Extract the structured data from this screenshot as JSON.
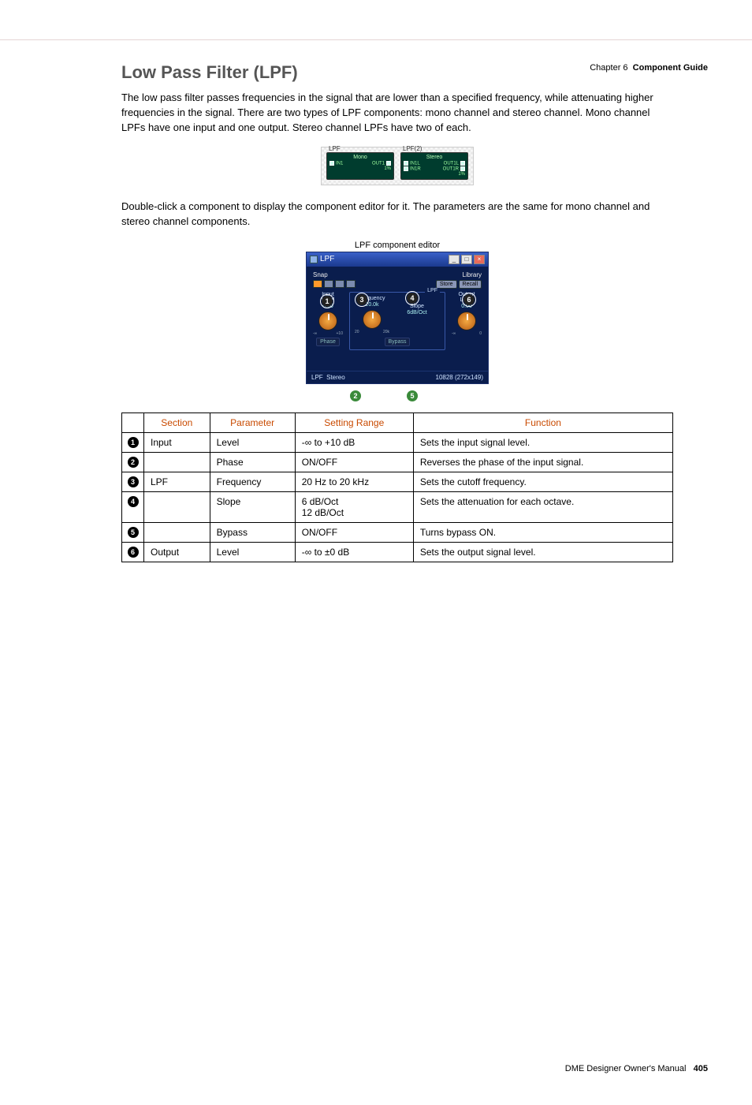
{
  "header": {
    "chapter": "Chapter 6",
    "section": "Component Guide"
  },
  "title": "Low Pass Filter (LPF)",
  "para1": "The low pass filter passes frequencies in the signal that are lower than a specified frequency, while attenuating higher frequencies in the signal. There are two types of LPF components: mono channel and stereo channel. Mono channel LPFs have one input and one output. Stereo channel LPFs have two of each.",
  "para2": "Double-click a component to display the component editor for it. The parameters are the same for mono channel and stereo channel components.",
  "thumbs": {
    "mono": {
      "title": "LPF",
      "mode": "Mono",
      "in": "IN1",
      "out": "OUT1",
      "pct": "1%"
    },
    "stereo": {
      "title": "LPF(2)",
      "mode": "Stereo",
      "in1": "IN1L",
      "out1": "OUT1L",
      "in2": "IN1R",
      "out2": "OUT1R",
      "pct": "1%"
    }
  },
  "editor": {
    "caption": "LPF component editor",
    "window_title": "LPF",
    "snap_label": "Snap",
    "library_label": "Library",
    "store_btn": "Store",
    "recall_btn": "Recall",
    "input": {
      "label": "Input",
      "level_label": "Level",
      "level_value": "0.00",
      "tick_lo": "-∞",
      "tick_hi": "+10",
      "phase_btn": "Phase"
    },
    "lpf": {
      "frame": "LPF",
      "freq_label": "Frequency",
      "freq_value": "20.0k",
      "tick_lo": "20",
      "tick_hi": "20k",
      "slope_label": "Slope",
      "slope_value": "6dB/Oct",
      "bypass_btn": "Bypass"
    },
    "output": {
      "label": "Output",
      "level_label": "Level",
      "level_value": "0.00",
      "tick_lo": "-∞",
      "tick_hi": "0"
    },
    "status_left": "LPF",
    "status_mid": "Stereo",
    "status_right": "10828  (272x149)"
  },
  "table": {
    "head": {
      "section": "Section",
      "param": "Parameter",
      "range": "Setting Range",
      "func": "Function"
    },
    "rows": [
      {
        "n": "1",
        "section": "Input",
        "param": "Level",
        "range": "-∞ to +10 dB",
        "func": "Sets the input signal level."
      },
      {
        "n": "2",
        "section": "",
        "param": "Phase",
        "range": "ON/OFF",
        "func": "Reverses the phase of the input signal."
      },
      {
        "n": "3",
        "section": "LPF",
        "param": "Frequency",
        "range": "20 Hz to 20 kHz",
        "func": "Sets the cutoff frequency."
      },
      {
        "n": "4",
        "section": "",
        "param": "Slope",
        "range": "6 dB/Oct\n12 dB/Oct",
        "func": "Sets the attenuation for each octave."
      },
      {
        "n": "5",
        "section": "",
        "param": "Bypass",
        "range": "ON/OFF",
        "func": "Turns bypass ON."
      },
      {
        "n": "6",
        "section": "Output",
        "param": "Level",
        "range": "-∞ to ±0 dB",
        "func": "Sets the output signal level."
      }
    ]
  },
  "footer": {
    "doc": "DME Designer Owner's Manual",
    "page": "405"
  }
}
